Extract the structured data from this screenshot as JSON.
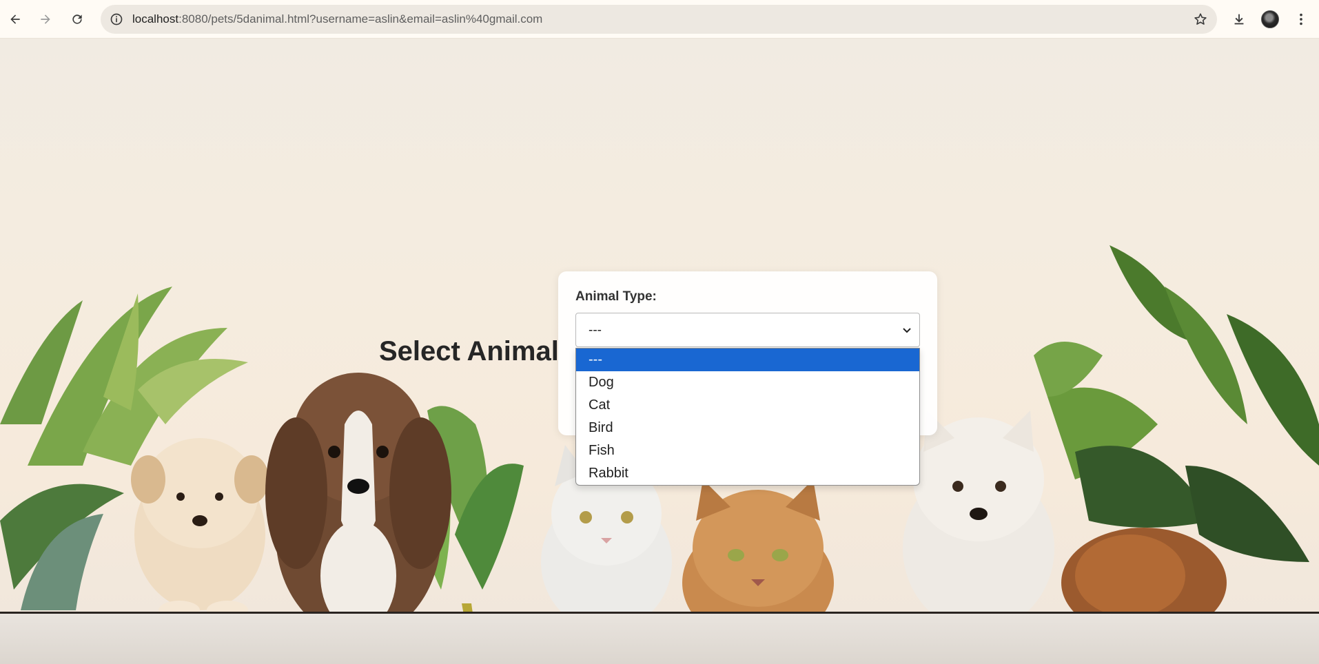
{
  "browser": {
    "url_host": "localhost",
    "url_rest": ":8080/pets/5danimal.html?username=aslin&email=aslin%40gmail.com"
  },
  "page": {
    "heading": "Select Animal"
  },
  "form": {
    "label": "Animal Type:",
    "selected_value": "---",
    "options": [
      "---",
      "Dog",
      "Cat",
      "Bird",
      "Fish",
      "Rabbit"
    ],
    "highlighted_option": "---"
  },
  "colors": {
    "highlight": "#1967d2",
    "submit_button": "#2e7d32"
  },
  "icons": {
    "back": "arrow-left-icon",
    "forward": "arrow-right-icon",
    "reload": "reload-icon",
    "site_info": "info-icon",
    "bookmark": "star-icon",
    "downloads": "download-icon",
    "menu": "kebab-menu-icon"
  }
}
